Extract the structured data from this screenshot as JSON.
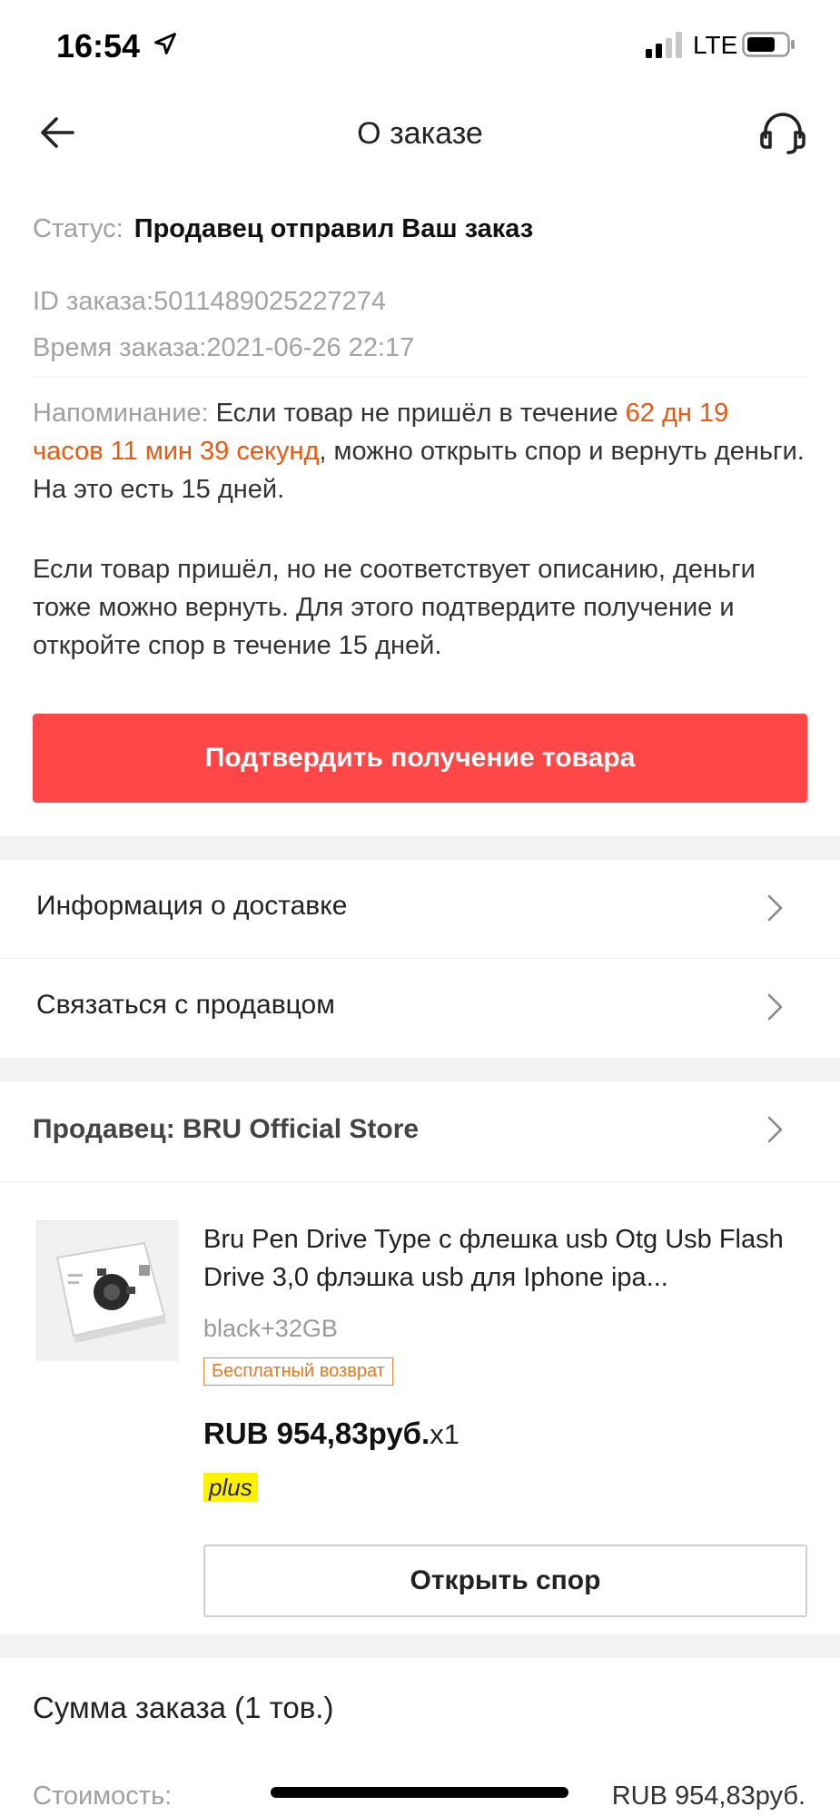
{
  "status_bar": {
    "time": "16:54",
    "network": "LTE",
    "icons": [
      "location-arrow-icon",
      "signal-icon",
      "battery-icon"
    ]
  },
  "header": {
    "title": "О заказе",
    "back_icon": "back-arrow-icon",
    "support_icon": "headset-icon"
  },
  "order": {
    "status_label": "Статус:",
    "status_value": "Продавец отправил Ваш заказ",
    "id_text": "ID заказа:5011489025227274",
    "time_text": "Время заказа:2021-06-26 22:17"
  },
  "reminder": {
    "label": "Напоминание:",
    "text_before": " Если товар не пришёл в течение ",
    "countdown": "62 дн 19 часов 11 мин 39 секунд",
    "text_after": ", можно открыть спор и вернуть деньги. На это есть 15 дней.",
    "paragraph2": "Если товар пришёл, но не соответствует описанию, деньги тоже можно вернуть. Для этого подтвердите получение и откройте спор в течение 15 дней."
  },
  "confirm_button": "Подтвердить получение товара",
  "menu": {
    "delivery_info": "Информация о доставке",
    "contact_seller": "Связаться с продавцом"
  },
  "seller": {
    "label": "Продавец: BRU Official Store"
  },
  "product": {
    "title": "Bru Pen Drive Type с флешка usb Otg Usb Flash Drive 3,0 флэшка usb для Iphone ipa...",
    "variant": "black+32GB",
    "badge": "Бесплатный возврат",
    "price": "RUB 954,83руб.",
    "quantity": "x1",
    "plus_label": "plus"
  },
  "dispute_button": "Открыть спор",
  "summary": {
    "title": "Сумма заказа (1 тов.)",
    "cost_label": "Стоимость:",
    "cost_value": "RUB 954,83руб."
  },
  "colors": {
    "accent_red": "#ff4747",
    "countdown_orange": "#e85a12",
    "plus_yellow": "#fff200"
  }
}
